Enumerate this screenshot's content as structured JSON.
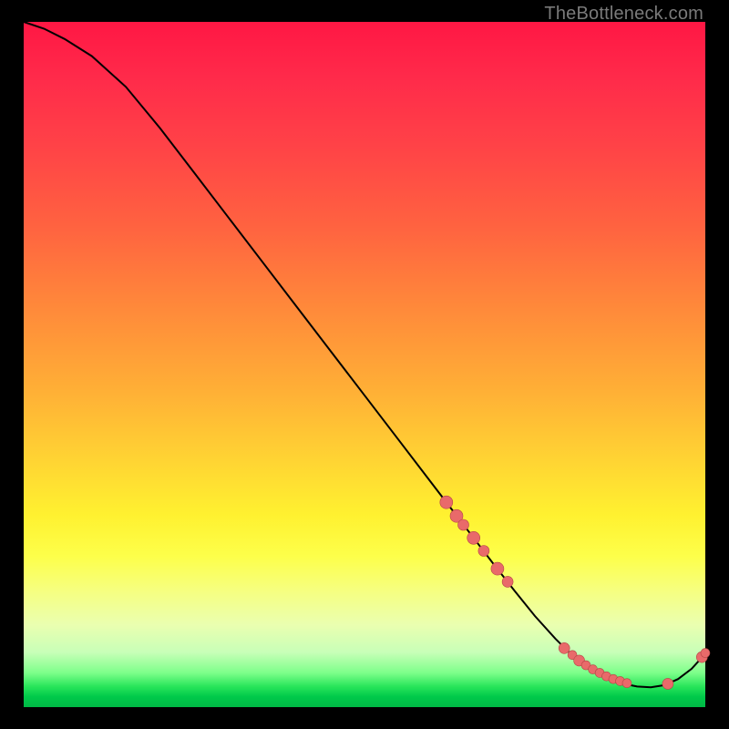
{
  "watermark": "TheBottleneck.com",
  "colors": {
    "curve": "#000000",
    "marker_fill": "#e96a6a",
    "marker_stroke": "#b44646"
  },
  "chart_data": {
    "type": "line",
    "title": "",
    "xlabel": "",
    "ylabel": "",
    "xlim": [
      0,
      100
    ],
    "ylim": [
      0,
      100
    ],
    "grid": false,
    "series": [
      {
        "name": "curve",
        "x": [
          0,
          3,
          6,
          10,
          15,
          20,
          25,
          30,
          35,
          40,
          45,
          50,
          55,
          60,
          63,
          66,
          69,
          72,
          75,
          78,
          80,
          82,
          84,
          86,
          88,
          90,
          92,
          94,
          96,
          98,
          100
        ],
        "y": [
          100,
          99,
          97.5,
          95,
          90.5,
          84.5,
          78,
          71.5,
          65,
          58.5,
          52,
          45.5,
          39,
          32.5,
          28.6,
          24.7,
          20.8,
          17,
          13.3,
          10,
          8,
          6.4,
          5.1,
          4.1,
          3.4,
          3.0,
          2.9,
          3.2,
          4.1,
          5.6,
          7.8
        ]
      }
    ],
    "markers": [
      {
        "x": 62.0,
        "y": 29.9,
        "r": 7
      },
      {
        "x": 63.5,
        "y": 27.9,
        "r": 7
      },
      {
        "x": 64.5,
        "y": 26.6,
        "r": 6
      },
      {
        "x": 66.0,
        "y": 24.7,
        "r": 7
      },
      {
        "x": 67.5,
        "y": 22.8,
        "r": 6
      },
      {
        "x": 69.5,
        "y": 20.2,
        "r": 7
      },
      {
        "x": 71.0,
        "y": 18.3,
        "r": 6
      },
      {
        "x": 79.3,
        "y": 8.6,
        "r": 6
      },
      {
        "x": 80.5,
        "y": 7.6,
        "r": 5
      },
      {
        "x": 81.5,
        "y": 6.8,
        "r": 6
      },
      {
        "x": 82.5,
        "y": 6.1,
        "r": 5
      },
      {
        "x": 83.5,
        "y": 5.5,
        "r": 5
      },
      {
        "x": 84.5,
        "y": 5.0,
        "r": 5
      },
      {
        "x": 85.5,
        "y": 4.5,
        "r": 5
      },
      {
        "x": 86.5,
        "y": 4.1,
        "r": 5
      },
      {
        "x": 87.5,
        "y": 3.8,
        "r": 5
      },
      {
        "x": 88.5,
        "y": 3.5,
        "r": 5
      },
      {
        "x": 94.5,
        "y": 3.4,
        "r": 6
      },
      {
        "x": 99.5,
        "y": 7.3,
        "r": 6
      },
      {
        "x": 100.0,
        "y": 7.9,
        "r": 5
      }
    ]
  }
}
